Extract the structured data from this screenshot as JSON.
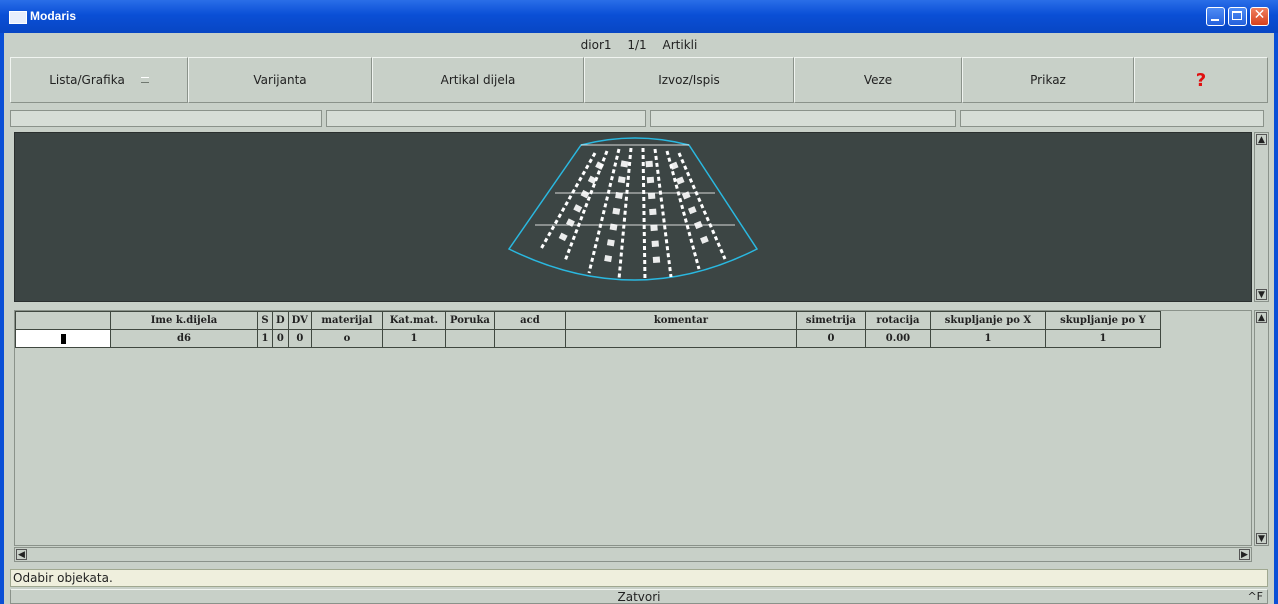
{
  "window": {
    "title": "Modaris"
  },
  "header": {
    "file": "dior1",
    "counter": "1/1",
    "section": "Artikli"
  },
  "toolbar": {
    "lista_label": "Lista/Grafika",
    "varijanta_label": "Varijanta",
    "artikal_label": "Artikal dijela",
    "izvoz_label": "Izvoz/Ispis",
    "veze_label": "Veze",
    "prikaz_label": "Prikaz",
    "help_glyph": "?"
  },
  "table": {
    "headers": [
      "",
      "Ime k.dijela",
      "S",
      "D",
      "DV",
      "materijal",
      "Kat.mat.",
      "Poruka",
      "acd",
      "komentar",
      "simetrija",
      "rotacija",
      "skupljanje po X",
      "skupljanje po Y"
    ],
    "rows": [
      [
        "",
        "d6",
        "1",
        "0",
        "0",
        "o",
        "1",
        "",
        "",
        "",
        "0",
        "0.00",
        "1",
        "1"
      ]
    ]
  },
  "status": {
    "text": "Odabir objekata."
  },
  "footer": {
    "close_label": "Zatvori",
    "shortcut": "^F"
  },
  "colors": {
    "canvas_bg": "#3c4544",
    "piece_outline": "#2ab8e0",
    "title_bar": "#0a4fd6"
  }
}
